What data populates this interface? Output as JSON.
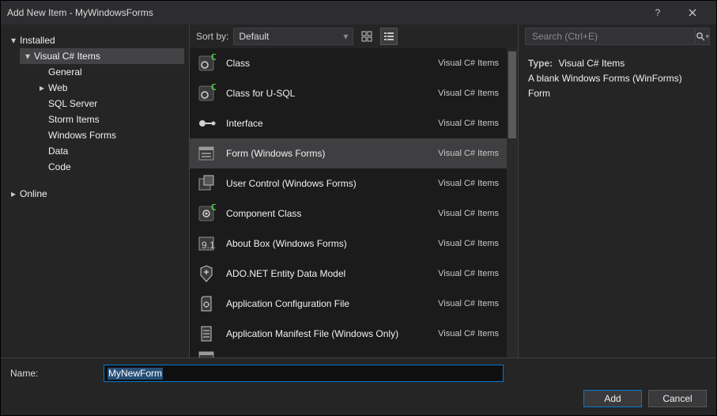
{
  "window": {
    "title": "Add New Item - MyWindowsForms"
  },
  "tree": {
    "installed": "Installed",
    "root": "Visual C# Items",
    "children": [
      "General",
      "Web",
      "SQL Server",
      "Storm Items",
      "Windows Forms",
      "Data",
      "Code"
    ],
    "online": "Online"
  },
  "toolbar": {
    "sort_label": "Sort by:",
    "sort_value": "Default"
  },
  "search": {
    "placeholder": "Search (Ctrl+E)"
  },
  "items": [
    {
      "name": "Class",
      "cat": "Visual C# Items",
      "icon": "class"
    },
    {
      "name": "Class for U-SQL",
      "cat": "Visual C# Items",
      "icon": "class"
    },
    {
      "name": "Interface",
      "cat": "Visual C# Items",
      "icon": "interface"
    },
    {
      "name": "Form (Windows Forms)",
      "cat": "Visual C# Items",
      "icon": "form",
      "selected": true
    },
    {
      "name": "User Control (Windows Forms)",
      "cat": "Visual C# Items",
      "icon": "usercontrol"
    },
    {
      "name": "Component Class",
      "cat": "Visual C# Items",
      "icon": "component"
    },
    {
      "name": "About Box (Windows Forms)",
      "cat": "Visual C# Items",
      "icon": "about"
    },
    {
      "name": "ADO.NET Entity Data Model",
      "cat": "Visual C# Items",
      "icon": "ado"
    },
    {
      "name": "Application Configuration File",
      "cat": "Visual C# Items",
      "icon": "config"
    },
    {
      "name": "Application Manifest File (Windows Only)",
      "cat": "Visual C# Items",
      "icon": "manifest"
    }
  ],
  "details": {
    "type_label": "Type:",
    "type_value": "Visual C# Items",
    "description": "A blank Windows Forms (WinForms) Form"
  },
  "name_field": {
    "label": "Name:",
    "value": "MyNewForm"
  },
  "buttons": {
    "add": "Add",
    "cancel": "Cancel"
  }
}
